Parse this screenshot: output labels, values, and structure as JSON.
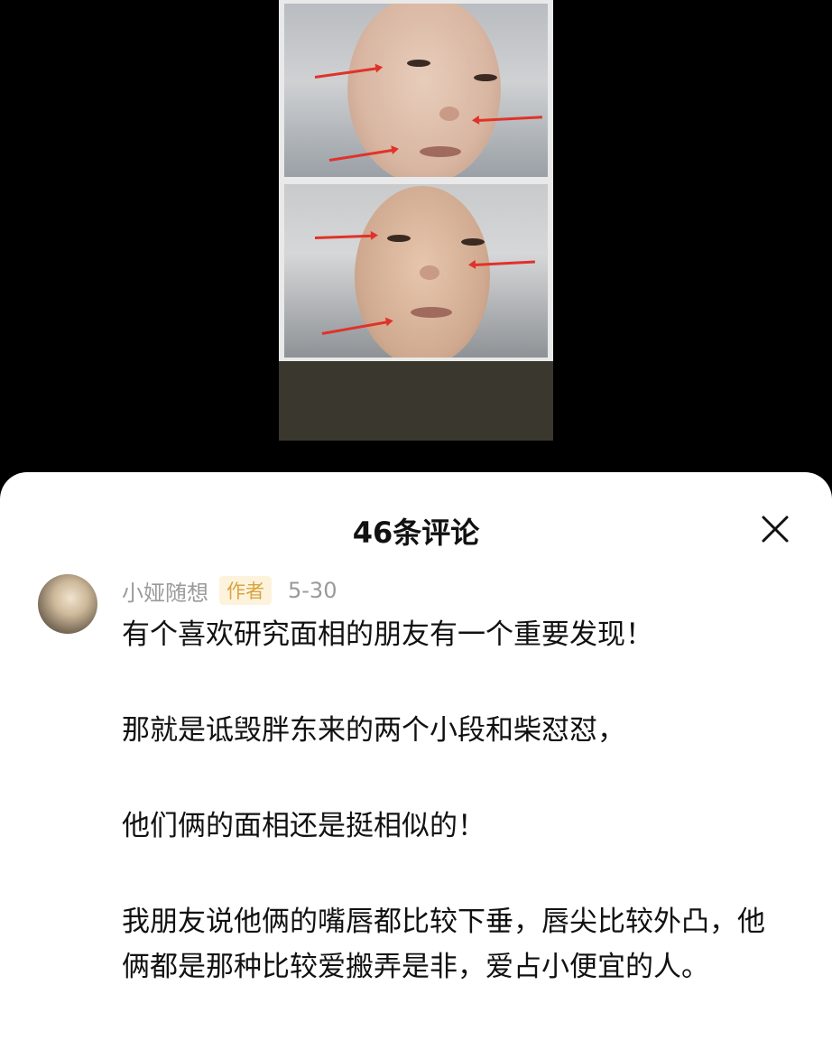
{
  "sheet": {
    "title": "46条评论"
  },
  "comment": {
    "author": "小娅随想",
    "badge": "作者",
    "date": "5-30",
    "paragraphs": [
      "有个喜欢研究面相的朋友有一个重要发现！",
      "那就是诋毁胖东来的两个小段和柴怼怼，",
      "他们俩的面相还是挺相似的！",
      "我朋友说他俩的嘴唇都比较下垂，唇尖比较外凸，他俩都是那种比较爱搬弄是非，爱占小便宜的人。"
    ]
  },
  "icons": {
    "close": "close-icon"
  },
  "colors": {
    "badge_bg": "#fdf3dc",
    "badge_text": "#d9a441",
    "arrow": "#e0322a"
  }
}
